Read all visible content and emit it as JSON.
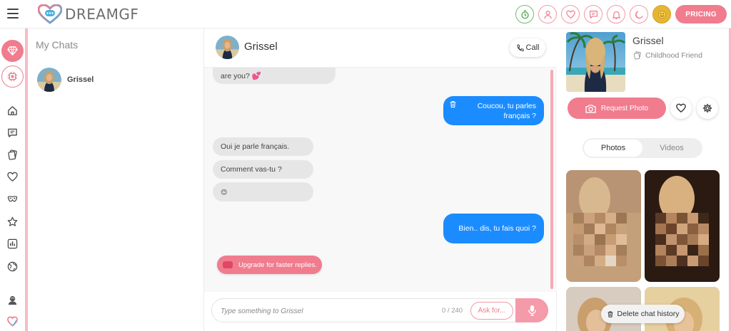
{
  "app": {
    "brand": "DREAMGF",
    "pricing_label": "PRICING"
  },
  "top_icons": [
    "refresh-timer-icon",
    "profile-icon",
    "heart-icon",
    "chat-icon",
    "bell-icon",
    "moon-icon",
    "smile-icon"
  ],
  "chats": {
    "title": "My Chats",
    "items": [
      {
        "name": "Grissel"
      }
    ]
  },
  "conversation": {
    "name": "Grissel",
    "call_label": "Call",
    "messages": [
      {
        "from": "her",
        "text": "are you? 💕"
      },
      {
        "from": "me",
        "text": "Coucou, tu parles français ?"
      },
      {
        "from": "her",
        "text": "Oui je parle français."
      },
      {
        "from": "her",
        "text": "Comment vas-tu ?"
      },
      {
        "from": "her",
        "text": "😊"
      },
      {
        "from": "me",
        "text": "Bien.. dis, tu fais quoi ?"
      }
    ],
    "upgrade_label": "Upgrade for faster replies.",
    "input_placeholder": "Type something to Grissel",
    "char_count": "0 / 240",
    "ask_label": "Ask for..."
  },
  "profile": {
    "name": "Grissel",
    "relationship": "Childhood Friend",
    "request_photo_label": "Request Photo",
    "tabs": [
      {
        "label": "Photos",
        "active": true
      },
      {
        "label": "Videos",
        "active": false
      }
    ],
    "delete_history_label": "Delete chat history"
  },
  "colors": {
    "accent": "#f07c8e",
    "outgoing_bubble": "#1a8cff",
    "incoming_bubble": "#e6e6e6"
  }
}
